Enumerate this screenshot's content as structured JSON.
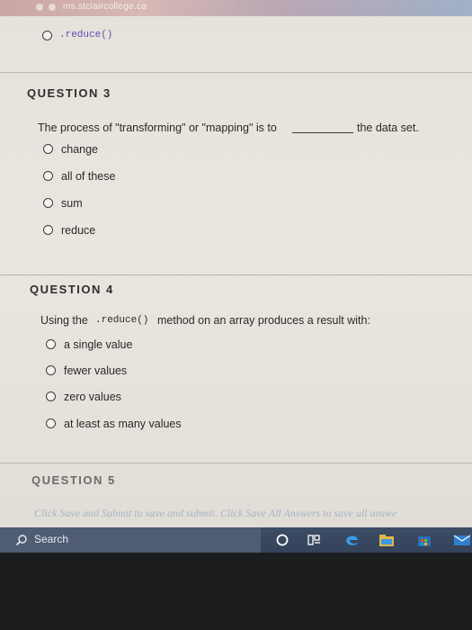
{
  "browser": {
    "url_text": "ms.stclaircollege.ca"
  },
  "prev_option": {
    "label": ".reduce()"
  },
  "question3": {
    "header": "QUESTION 3",
    "prompt_before": "The process of \"transforming\" or \"mapping\" is to",
    "prompt_after": "the data set.",
    "options": [
      "change",
      "all of these",
      "sum",
      "reduce"
    ]
  },
  "question4": {
    "header": "QUESTION 4",
    "prompt_before": "Using the",
    "prompt_code": ".reduce()",
    "prompt_after": "method on an array produces a result with:",
    "options": [
      "a single value",
      "fewer values",
      "zero values",
      "at least as many values"
    ]
  },
  "question5": {
    "header": "QUESTION 5"
  },
  "footer": {
    "instruction": "Click Save and Submit to save and submit. Click Save All Answers to save all answe"
  },
  "taskbar": {
    "search_label": "Search",
    "icons": [
      "cortana-icon",
      "task-view-icon",
      "edge-icon",
      "file-explorer-icon",
      "store-icon",
      "mail-icon"
    ]
  },
  "colors": {
    "page_bg": "#e6e2db",
    "taskbar": "#3d4d66",
    "footer_link": "#7a8fb8"
  }
}
